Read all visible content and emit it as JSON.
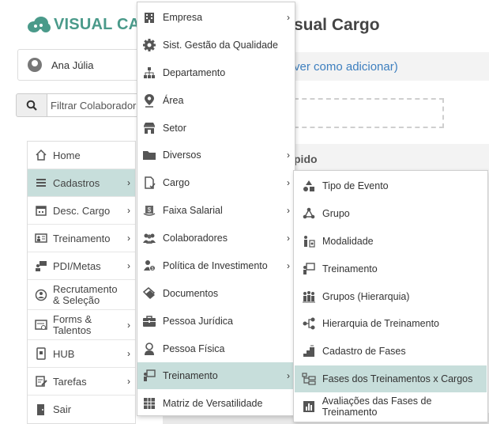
{
  "brand": {
    "part1": "VISUAL",
    "part2": "CARGO"
  },
  "user": {
    "name": "Ana Júlia"
  },
  "search": {
    "placeholder": "Filtrar Colaborador"
  },
  "page": {
    "title": "sual Cargo",
    "link": "ver como adicionar)",
    "section": "pido"
  },
  "nav": {
    "items": [
      {
        "label": "Home",
        "icon": "home-icon"
      },
      {
        "label": "Cadastros",
        "icon": "list-icon"
      },
      {
        "label": "Desc. Cargo",
        "icon": "calendar-icon"
      },
      {
        "label": "Treinamento",
        "icon": "presentation-icon"
      },
      {
        "label": "PDI/Metas",
        "icon": "target-icon"
      },
      {
        "label_line1": "Recrutamento",
        "label_line2": "& Seleção",
        "icon": "user-search-icon"
      },
      {
        "label_line1": "Forms &",
        "label_line2": "Talentos",
        "icon": "form-icon"
      },
      {
        "label": "HUB",
        "icon": "hub-icon"
      },
      {
        "label": "Tarefas",
        "icon": "tasks-icon"
      },
      {
        "label": "Sair",
        "icon": "exit-icon"
      }
    ]
  },
  "cadastros_menu": {
    "items": [
      {
        "label": "Empresa",
        "icon": "building-icon"
      },
      {
        "label": "Sist. Gestão da Qualidade",
        "icon": "gear-icon"
      },
      {
        "label": "Departamento",
        "icon": "org-chart-icon"
      },
      {
        "label": "Área",
        "icon": "map-pin-icon"
      },
      {
        "label": "Setor",
        "icon": "store-icon"
      },
      {
        "label": "Diversos",
        "icon": "folder-icon"
      },
      {
        "label": "Cargo",
        "icon": "document-icon"
      },
      {
        "label": "Faixa Salarial",
        "icon": "money-icon"
      },
      {
        "label": "Colaboradores",
        "icon": "people-icon"
      },
      {
        "label": "Política de Investimento",
        "icon": "investor-icon"
      },
      {
        "label": "Documentos",
        "icon": "documents-icon"
      },
      {
        "label": "Pessoa Jurídica",
        "icon": "briefcase-icon"
      },
      {
        "label": "Pessoa Física",
        "icon": "person-icon"
      },
      {
        "label": "Treinamento",
        "icon": "presentation-icon"
      },
      {
        "label": "Matriz de Versatilidade",
        "icon": "matrix-icon"
      }
    ]
  },
  "treinamento_menu": {
    "items": [
      {
        "label": "Tipo de Evento",
        "icon": "shapes-icon"
      },
      {
        "label": "Grupo",
        "icon": "group-icon"
      },
      {
        "label": "Modalidade",
        "icon": "modality-icon"
      },
      {
        "label": "Treinamento",
        "icon": "presentation-icon"
      },
      {
        "label": "Grupos (Hierarquia)",
        "icon": "group-hierarchy-icon"
      },
      {
        "label": "Hierarquia de Treinamento",
        "icon": "hierarchy-icon"
      },
      {
        "label": "Cadastro de Fases",
        "icon": "stairs-icon"
      },
      {
        "label": "Fases dos Treinamentos x Cargos",
        "icon": "phases-icon"
      },
      {
        "label": "Avaliações das Fases de Treinamento",
        "icon": "bar-chart-icon"
      }
    ]
  },
  "colors": {
    "accent": "#4a9a8a",
    "active_bg": "#c7dedb",
    "link": "#3d7fbf"
  }
}
